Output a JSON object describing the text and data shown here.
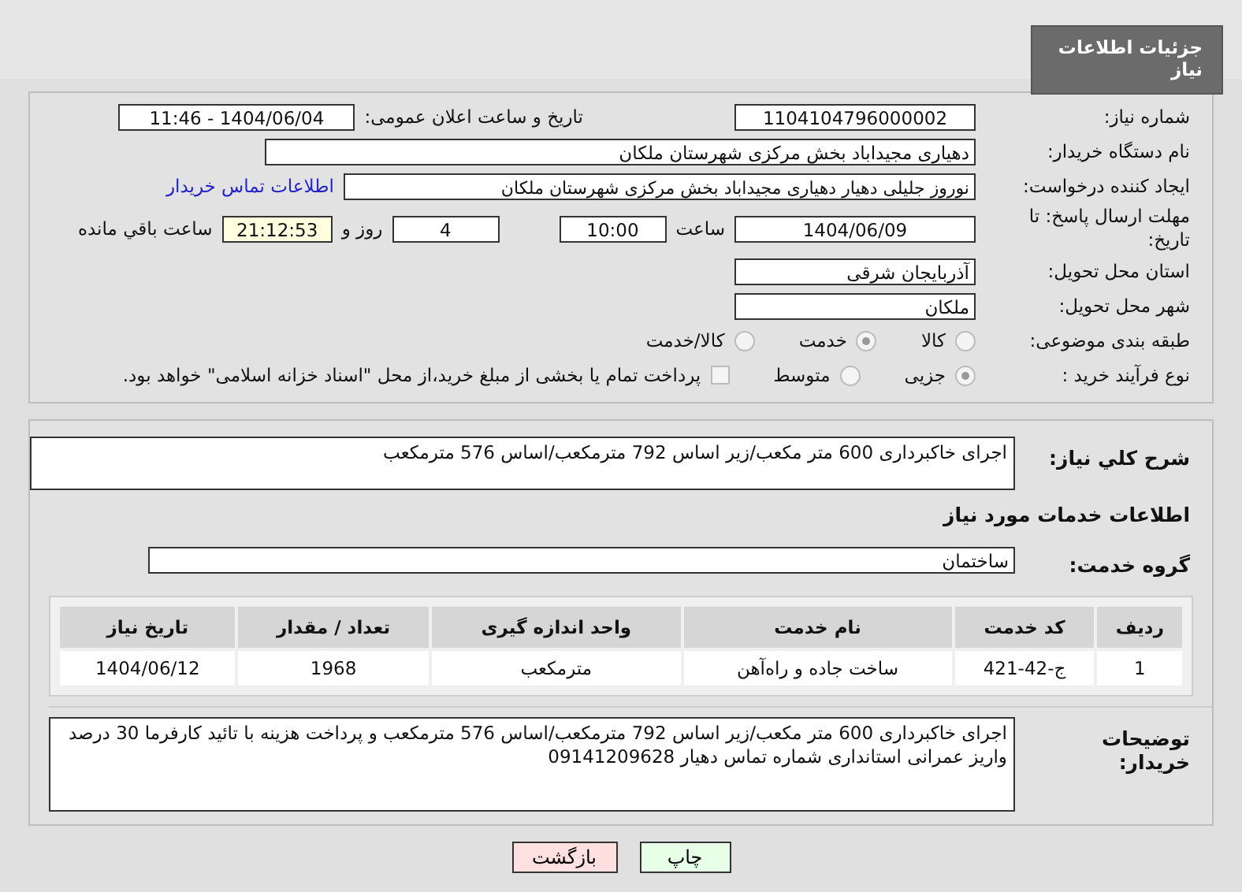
{
  "header": {
    "title": "جزئیات اطلاعات نیاز"
  },
  "need_number": {
    "label": "شماره نیاز:",
    "value": "1104104796000002"
  },
  "announce": {
    "label": "تاریخ و ساعت اعلان عمومی:",
    "value": "1404/06/04 - 11:46"
  },
  "buyer_org": {
    "label": "نام دستگاه خریدار:",
    "value": "دهیاری مجیداباد بخش مرکزی شهرستان ملکان"
  },
  "requester": {
    "label": "ایجاد کننده درخواست:",
    "value": "نوروز جلیلی دهیار دهیاری مجیداباد بخش مرکزی شهرستان ملکان",
    "link": "اطلاعات تماس خریدار"
  },
  "deadline": {
    "label": "مهلت ارسال پاسخ: تا تاریخ:",
    "date": "1404/06/09",
    "time_label": "ساعت",
    "time": "10:00",
    "days": "4",
    "days_label": "روز و",
    "remaining": "21:12:53",
    "remaining_label": "ساعت باقي مانده"
  },
  "province": {
    "label": "استان محل تحویل:",
    "value": "آذربایجان شرقی"
  },
  "city": {
    "label": "شهر محل تحویل:",
    "value": "ملکان"
  },
  "category": {
    "label": "طبقه بندی موضوعی:",
    "options": [
      {
        "label": "کالا",
        "selected": false
      },
      {
        "label": "خدمت",
        "selected": true
      },
      {
        "label": "کالا/خدمت",
        "selected": false
      }
    ]
  },
  "process": {
    "label": "نوع فرآیند خرید :",
    "options": [
      {
        "label": "جزیی",
        "selected": true
      },
      {
        "label": "متوسط",
        "selected": false
      }
    ],
    "treasury": {
      "label": "پرداخت تمام یا بخشی از مبلغ خرید،از محل \"اسناد خزانه اسلامی\" خواهد بود.",
      "checked": false
    }
  },
  "description": {
    "label": "شرح کلي نیاز:",
    "value": "اجرای خاکبرداری 600 متر مکعب/زیر اساس 792 مترمکعب/اساس 576 مترمکعب"
  },
  "services_heading": "اطلاعات خدمات مورد نیاز",
  "service_group": {
    "label": "گروه خدمت:",
    "value": "ساختمان"
  },
  "table": {
    "columns": [
      "ردیف",
      "کد خدمت",
      "نام خدمت",
      "واحد اندازه گیری",
      "تعداد / مقدار",
      "تاریخ نیاز"
    ],
    "rows": [
      [
        "1",
        "ج-42-421",
        "ساخت جاده و راه‌آهن",
        "مترمکعب",
        "1968",
        "1404/06/12"
      ]
    ]
  },
  "buyer_notes": {
    "label": "توضیحات خریدار:",
    "value": "اجرای خاکبرداری 600 متر مکعب/زیر اساس 792 مترمکعب/اساس 576 مترمکعب و پرداخت هزینه با تائید کارفرما 30 درصد واریز عمرانی استانداری  شماره تماس دهیار 09141209628"
  },
  "buttons": [
    {
      "label": "چاپ",
      "kind": "print"
    },
    {
      "label": "بازگشت",
      "kind": "back"
    }
  ]
}
